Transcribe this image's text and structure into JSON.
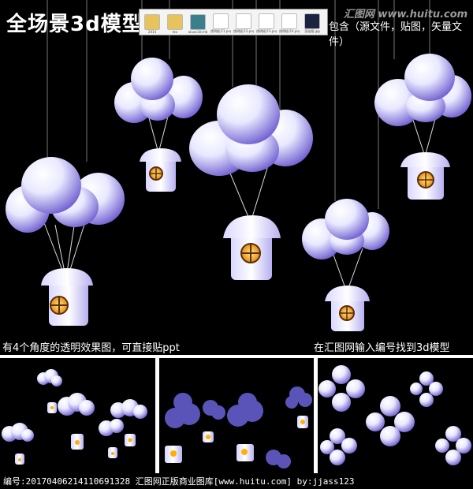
{
  "header": {
    "title": "全场景3d模型",
    "includes_text": "包含（源文件，贴图，矢量文件）",
    "watermark": "汇图网 www.huitu.com",
    "thumbnails": [
      {
        "label": "2014",
        "color": "#e8c25a",
        "icon": "folder-icon"
      },
      {
        "label": "tex",
        "color": "#e8c25a",
        "icon": "folder-icon"
      },
      {
        "label": "aluosi3d.mb",
        "color": "#3a7f8c",
        "icon": "maya-file-icon"
      },
      {
        "label": "透明插子1.png",
        "color": "#ffffff",
        "icon": "image-file-icon"
      },
      {
        "label": "透明插子2.png",
        "color": "#ffffff",
        "icon": "image-file-icon"
      },
      {
        "label": "透明插子3.png",
        "color": "#ffffff",
        "icon": "image-file-icon"
      },
      {
        "label": "透明插子4.png",
        "color": "#ffffff",
        "icon": "image-file-icon"
      },
      {
        "label": "渲染图.jpg",
        "color": "#1a2340",
        "icon": "image-file-icon"
      }
    ]
  },
  "captions": {
    "left": "有4个角度的透明效果图，可直接贴ppt",
    "right": "在汇图网输入编号找到3d模型"
  },
  "footer": {
    "text": "编号:20170406214110691328  汇图网正版商业图库[www.huitu.com]  by:jjass123"
  },
  "colors": {
    "balloon": "#e6e6ff",
    "balloon_shade": "#7d6fd6",
    "window": "#ffb000",
    "background": "#000000"
  }
}
